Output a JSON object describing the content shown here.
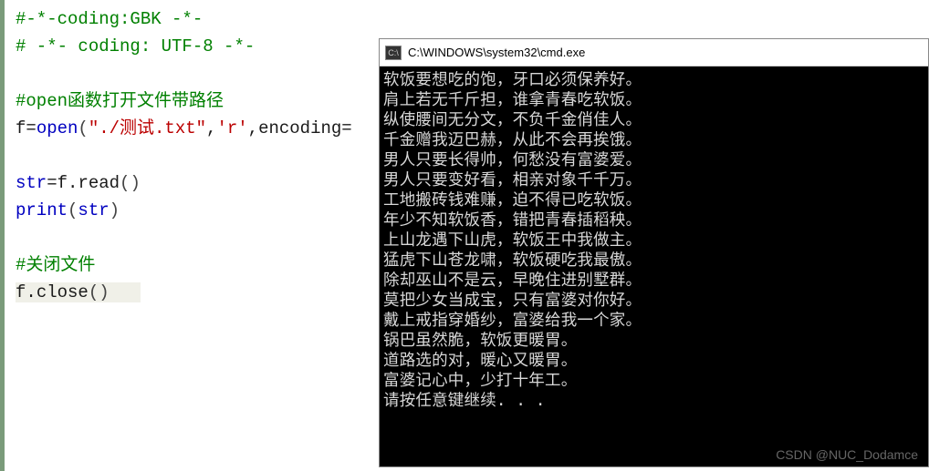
{
  "editor": {
    "lines": {
      "l1": "#-*-coding:GBK -*-",
      "l2": "# -*- coding: UTF-8 -*-",
      "l3": "",
      "comment_open": "#open函数打开文件带路径",
      "open_var": "f",
      "open_eq": "=",
      "open_func": "open",
      "open_lparen": "(",
      "open_arg1": "\"./测试.txt\"",
      "open_comma1": ",",
      "open_arg2": "'r'",
      "open_comma2": ",",
      "open_kw": "encoding",
      "open_eq2": "=",
      "str_var": "str",
      "read_eq": "=f.",
      "read_func": "read",
      "read_paren": "()",
      "print_func": "print",
      "print_lparen": "(",
      "print_arg": "str",
      "print_rparen": ")",
      "comment_close": "#关闭文件",
      "close_call_f": "f.",
      "close_func": "close",
      "close_paren": "()"
    }
  },
  "cmd": {
    "icon_label": "C:\\",
    "title": "C:\\WINDOWS\\system32\\cmd.exe",
    "output": [
      "软饭要想吃的饱，牙口必须保养好。",
      "肩上若无千斤担，谁拿青春吃软饭。",
      "纵使腰间无分文，不负千金俏佳人。",
      "千金赠我迈巴赫，从此不会再挨饿。",
      "男人只要长得帅，何愁没有富婆爱。",
      "男人只要变好看，相亲对象千千万。",
      "工地搬砖钱难赚，迫不得已吃软饭。",
      "年少不知软饭香，错把青春插稻秧。",
      "上山龙遇下山虎，软饭王中我做主。",
      "猛虎下山苍龙啸，软饭硬吃我最傲。",
      "除却巫山不是云，早晚住进别墅群。",
      "莫把少女当成宝，只有富婆对你好。",
      "戴上戒指穿婚纱，富婆给我一个家。",
      "锅巴虽然脆，软饭更暖胃。",
      "道路选的对，暖心又暖胃。",
      "富婆记心中，少打十年工。",
      "请按任意键继续. . ."
    ]
  },
  "watermark": "CSDN @NUC_Dodamce"
}
